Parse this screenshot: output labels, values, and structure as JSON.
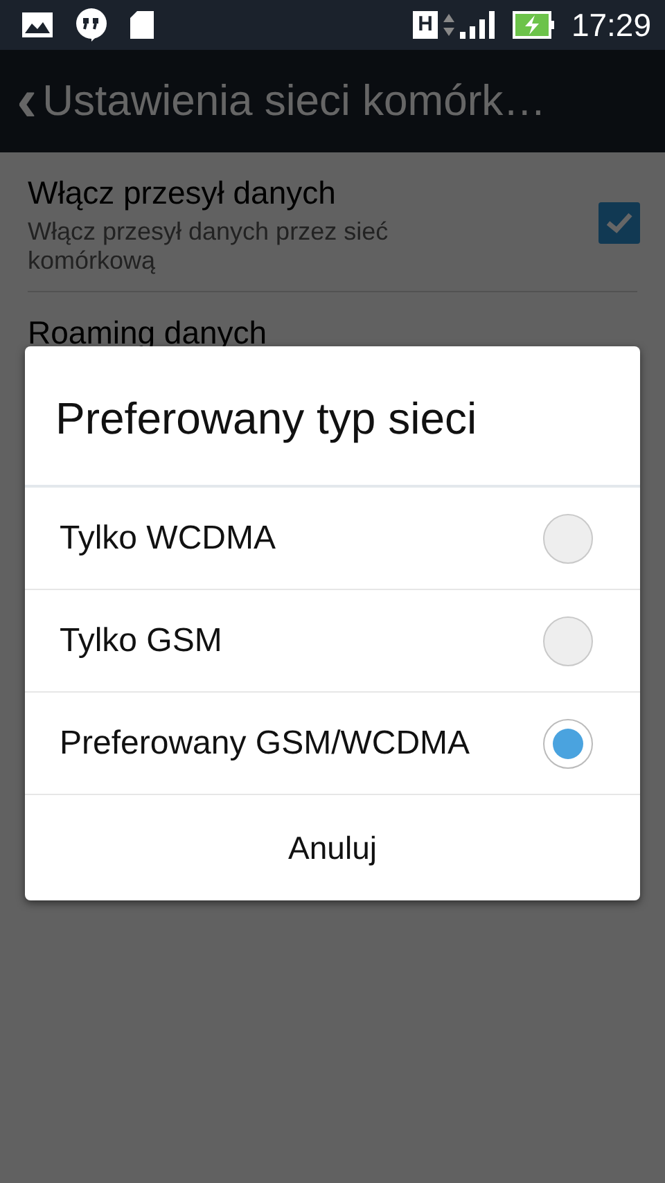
{
  "status_bar": {
    "network_type": "H",
    "time": "17:29"
  },
  "action_bar": {
    "back": "‹",
    "title": "Ustawienia sieci komórk…"
  },
  "settings": [
    {
      "title": "Włącz przesył danych",
      "summary": "Włącz przesył danych przez sieć komórkową",
      "checked": true
    },
    {
      "title": "Roaming danych"
    }
  ],
  "dialog": {
    "title": "Preferowany typ sieci",
    "options": [
      {
        "label": "Tylko WCDMA",
        "selected": false
      },
      {
        "label": "Tylko GSM",
        "selected": false
      },
      {
        "label": "Preferowany GSM/WCDMA",
        "selected": true
      }
    ],
    "button": "Anuluj"
  }
}
